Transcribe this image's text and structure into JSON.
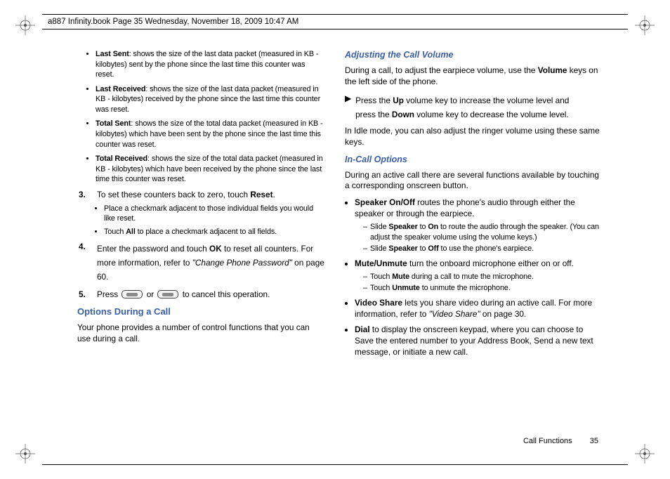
{
  "meta": {
    "crop_header": "a887 Infinity.book  Page 35  Wednesday, November 18, 2009  10:47 AM"
  },
  "left": {
    "bullets1": [
      {
        "term": "Last Sent",
        "desc": ": shows the size of the last data packet (measured in KB - kilobytes) sent by the phone since the last time this counter was reset."
      },
      {
        "term": "Last Received",
        "desc": ": shows the size of the last data packet (measured in KB - kilobytes) received by the phone since the last time this counter was reset."
      },
      {
        "term": "Total Sent",
        "desc": ": shows the size of the total data packet (measured in KB - kilobytes) which have been sent by the phone since the last time this counter was reset."
      },
      {
        "term": "Total Received",
        "desc": ": shows the size of the total data packet (measured in KB - kilobytes) which have been received by the phone since the last time this counter was reset."
      }
    ],
    "step3_num": "3.",
    "step3_a": "To set these counters back to zero, touch ",
    "step3_b": "Reset",
    "step3_c": ".",
    "sub_bullets": [
      "Place a checkmark adjacent to those individual fields you would like reset.",
      {
        "pre": "Touch ",
        "b": "All",
        "post": " to place a checkmark adjacent to all fields."
      }
    ],
    "step4_num": "4.",
    "step4_a": "Enter the password and touch ",
    "step4_b": "OK",
    "step4_c": " to reset all counters. For more information, refer to ",
    "step4_ref": "\"Change Phone Password\"",
    "step4_d": "  on page 60.",
    "step5_num": "5.",
    "step5_a": "Press ",
    "step5_mid": " or ",
    "step5_b": " to cancel this operation.",
    "section1": "Options During a Call",
    "section1_para": "Your phone provides a number of control functions that you can use during a call."
  },
  "right": {
    "sub1": "Adjusting the Call Volume",
    "p1_a": "During a call, to adjust the earpiece volume, use the ",
    "p1_b": "Volume",
    "p1_c": " keys on the left side of the phone.",
    "arrow_a": "Press the ",
    "arrow_b": "Up",
    "arrow_c": " volume key to increase the volume level and",
    "arrow2_a": "press the ",
    "arrow2_b": "Down",
    "arrow2_c": " volume key to decrease the volume level.",
    "p2": "In Idle mode, you can also adjust the ringer volume using these same keys.",
    "sub2": "In-Call Options",
    "p3": "During an active call there are several functions available by touching a corresponding onscreen button.",
    "rbul": [
      {
        "term": "Speaker On/Off",
        "desc": " routes the phone's audio through either the speaker or through the earpiece.",
        "sub": [
          {
            "a": "Slide ",
            "b": "Speaker",
            "c": " to ",
            "d": "On",
            "e": " to route the audio through the speaker. (You can adjust the speaker volume using the volume keys.)"
          },
          {
            "a": "Slide ",
            "b": "Speaker",
            "c": " to ",
            "d": "Off",
            "e": " to use the phone's earpiece."
          }
        ]
      },
      {
        "term": "Mute/Unmute",
        "desc": " turn the onboard microphone either on or off.",
        "sub": [
          {
            "a": "Touch ",
            "b": "Mute",
            "c": " during a call to mute the microphone.",
            "d": "",
            "e": ""
          },
          {
            "a": "Touch ",
            "b": "Unmute",
            "c": " to unmute the microphone.",
            "d": "",
            "e": ""
          }
        ]
      },
      {
        "term": "Video Share",
        "desc": " lets you share video during an active call. For more information, refer to ",
        "ref": "\"Video Share\"",
        "post": "  on page 30."
      },
      {
        "term": "Dial",
        "desc": " to display the onscreen keypad, where you can choose to Save the entered number to your Address Book, Send a new text message, or initiate a new call."
      }
    ]
  },
  "footer": {
    "section": "Call Functions",
    "page": "35"
  }
}
